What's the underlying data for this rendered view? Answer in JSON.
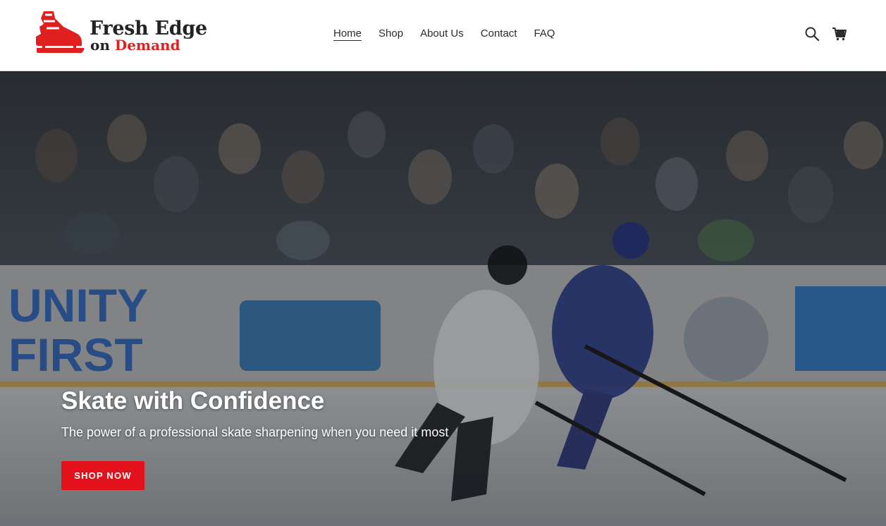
{
  "brand": {
    "name_line1": "Fresh Edge",
    "name_on": "on",
    "name_demand": "Demand",
    "primary_color": "#e01f1f",
    "dark_color": "#232323"
  },
  "nav": {
    "items": [
      {
        "label": "Home",
        "active": true
      },
      {
        "label": "Shop",
        "active": false
      },
      {
        "label": "About Us",
        "active": false
      },
      {
        "label": "Contact",
        "active": false
      },
      {
        "label": "FAQ",
        "active": false
      }
    ]
  },
  "header_icons": {
    "search": "search-icon",
    "cart": "cart-icon"
  },
  "hero": {
    "title": "Skate with Confidence",
    "subtitle": "The power of a professional skate sharpening when you need it most",
    "cta_label": "SHOP NOW",
    "cta_color": "#e3111b",
    "image": "hockey-game-photo"
  }
}
